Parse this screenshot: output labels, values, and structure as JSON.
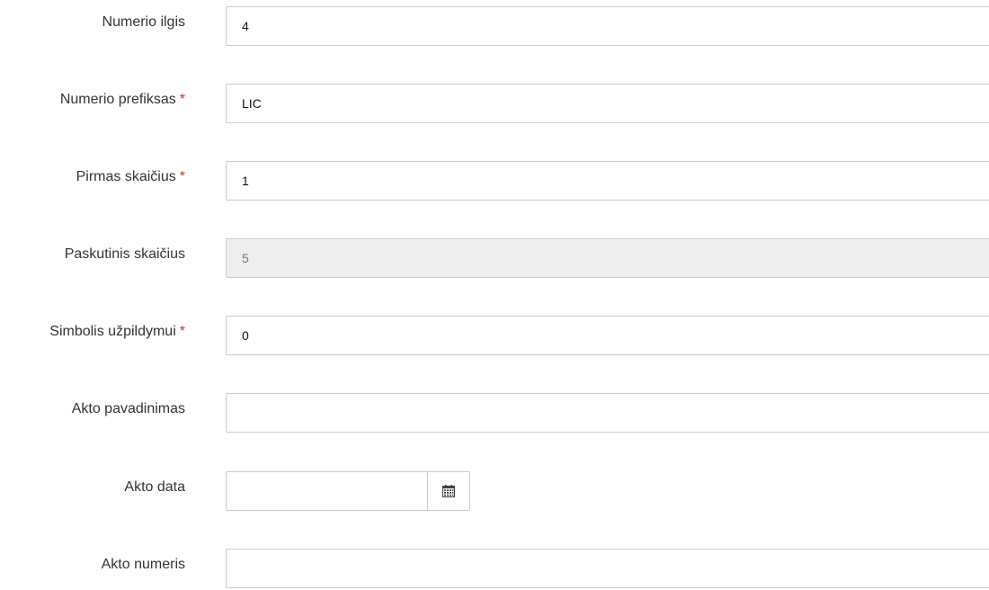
{
  "form": {
    "fields": [
      {
        "label": "Numerio ilgis",
        "required": false,
        "value": "4"
      },
      {
        "label": "Numerio prefiksas",
        "required": true,
        "value": "LIC"
      },
      {
        "label": "Pirmas skaičius",
        "required": true,
        "value": "1"
      },
      {
        "label": "Paskutinis skaičius",
        "required": false,
        "value": "5",
        "disabled": true
      },
      {
        "label": "Simbolis užpildymui",
        "required": true,
        "value": "0"
      },
      {
        "label": "Akto pavadinimas",
        "required": false,
        "value": ""
      },
      {
        "label": "Akto data",
        "required": false,
        "value": "",
        "addon_icon": "calendar-icon"
      },
      {
        "label": "Akto numeris",
        "required": false,
        "value": ""
      }
    ],
    "required_marker": "*"
  }
}
